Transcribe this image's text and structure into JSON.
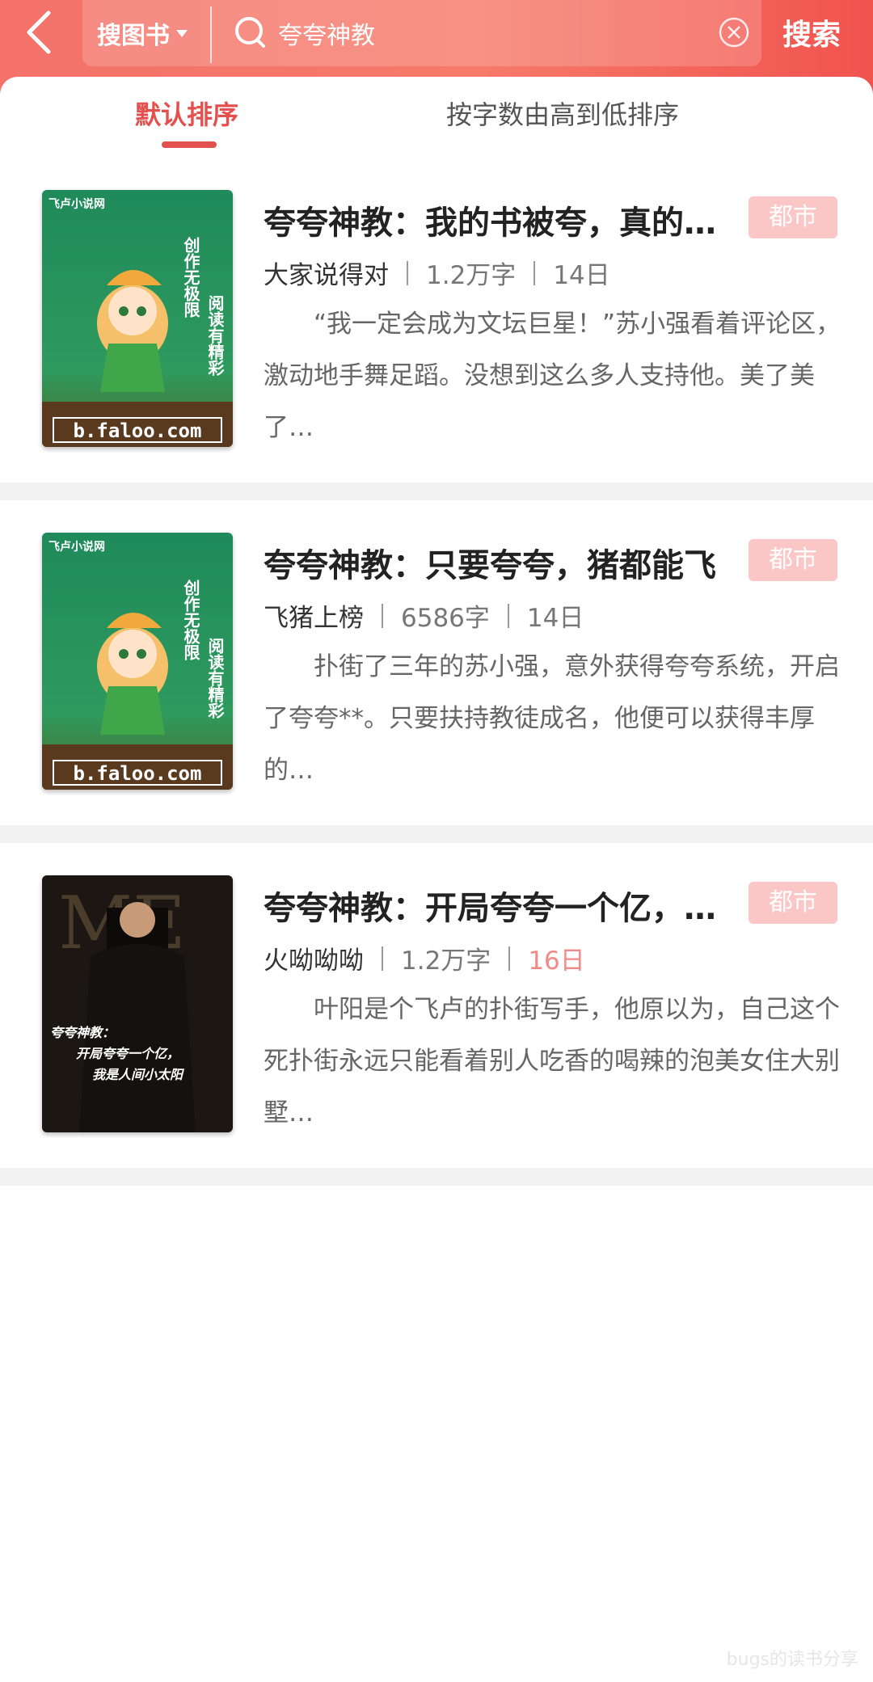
{
  "header": {
    "scope_label": "搜图书",
    "search_value": "夸夸神教",
    "search_button": "搜索"
  },
  "tabs": [
    {
      "label": "默认排序",
      "active": true
    },
    {
      "label": "按字数由高到低排序",
      "active": false
    }
  ],
  "books": [
    {
      "title": "夸夸神教：我的书被夸，真的…",
      "tag": "都市",
      "author": "大家说得对",
      "words": "1.2万字",
      "date": "14日",
      "desc": "“我一定会成为文坛巨星！”苏小强看着评论区，激动地手舞足蹈。没想到这么多人支持他。美了美了…",
      "cover": {
        "type": "faloo",
        "site": "b.faloo.com",
        "brand": "飞卢小说网",
        "slogan1": "创作无极限",
        "slogan2": "阅读有精彩"
      }
    },
    {
      "title": "夸夸神教：只要夸夸，猪都能飞",
      "tag": "都市",
      "author": "飞猪上榜",
      "words": "6586字",
      "date": "14日",
      "desc": "扑街了三年的苏小强，意外获得夸夸系统，开启了夸夸**。只要扶持教徒成名，他便可以获得丰厚的…",
      "cover": {
        "type": "faloo",
        "site": "b.faloo.com",
        "brand": "飞卢小说网",
        "slogan1": "创作无极限",
        "slogan2": "阅读有精彩"
      }
    },
    {
      "title": "夸夸神教：开局夸夸一个亿，…",
      "tag": "都市",
      "author": "火呦呦呦",
      "words": "1.2万字",
      "date": "16日",
      "date_highlight": true,
      "desc": "叶阳是个飞卢的扑街写手，他原以为，自己这个死扑街永远只能看着别人吃香的喝辣的泡美女住大别墅…",
      "cover": {
        "type": "photo",
        "line1": "夸夸神教：",
        "line2": "开局夸夸一个亿，",
        "line3": "我是人间小太阳"
      }
    }
  ],
  "watermark": "bugs的读书分享",
  "colors": {
    "accent": "#e4504e",
    "tag_bg": "#fbc7c6",
    "header_start": "#f4726a",
    "header_end": "#f1534f"
  }
}
